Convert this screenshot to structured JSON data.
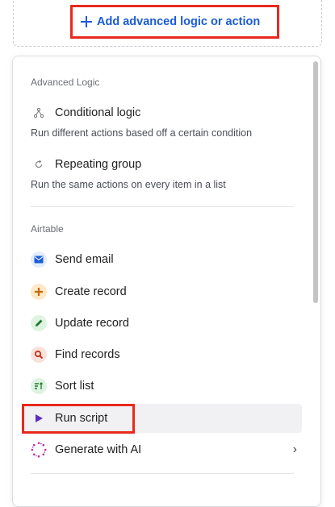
{
  "button": {
    "label": "Add advanced logic or action"
  },
  "advanced": {
    "title": "Advanced Logic",
    "items": [
      {
        "label": "Conditional logic",
        "description": "Run different actions based off a certain condition",
        "icon": "branch-icon"
      },
      {
        "label": "Repeating group",
        "description": "Run the same actions on every item in a list",
        "icon": "repeat-icon"
      }
    ]
  },
  "airtable": {
    "title": "Airtable",
    "actions": [
      {
        "label": "Send email",
        "icon": "email-icon",
        "color": "#1a5bd6",
        "bg": "#e4ecfb"
      },
      {
        "label": "Create record",
        "icon": "plus-icon",
        "color": "#c76a00",
        "bg": "#fde9c8"
      },
      {
        "label": "Update record",
        "icon": "pencil-icon",
        "color": "#1f7a2a",
        "bg": "#dff3e2"
      },
      {
        "label": "Find records",
        "icon": "magnifier-icon",
        "color": "#c0331b",
        "bg": "#fbe1dc"
      },
      {
        "label": "Sort list",
        "icon": "sort-icon",
        "color": "#1f7a2a",
        "bg": "#dff3e2"
      },
      {
        "label": "Run script",
        "icon": "play-icon",
        "color": "#5a2ec2",
        "bg": "transparent"
      },
      {
        "label": "Generate with AI",
        "icon": "ai-sparkle-icon",
        "color": "#c22a9a",
        "bg": "transparent"
      }
    ]
  }
}
